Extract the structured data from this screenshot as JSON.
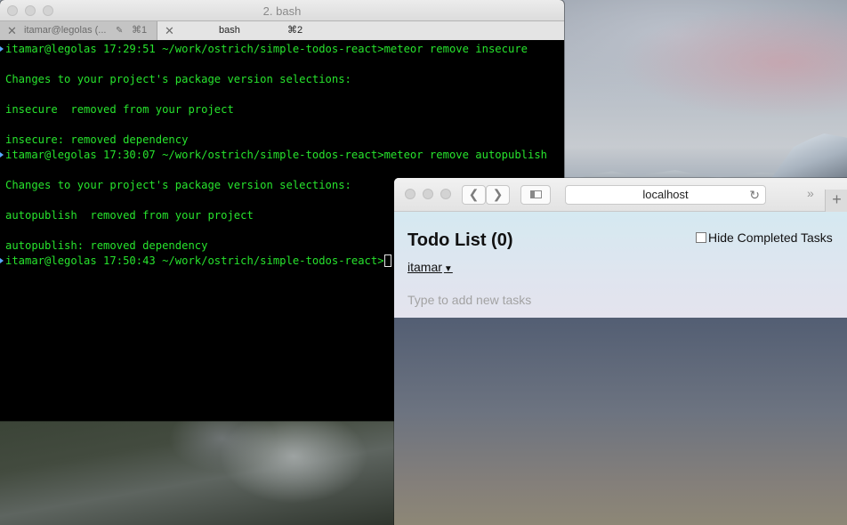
{
  "terminal": {
    "window_title": "2. bash",
    "tabs": [
      {
        "label": "itamar@legolas (...",
        "shortcut": "⌘1"
      },
      {
        "label": "bash",
        "shortcut": "⌘2"
      }
    ],
    "lines": [
      "itamar@legolas 17:29:51 ~/work/ostrich/simple-todos-react>meteor remove insecure",
      "",
      "Changes to your project's package version selections:",
      "",
      "insecure  removed from your project",
      "",
      "insecure: removed dependency",
      "itamar@legolas 17:30:07 ~/work/ostrich/simple-todos-react>meteor remove autopublish",
      "",
      "Changes to your project's package version selections:",
      "",
      "autopublish  removed from your project",
      "",
      "autopublish: removed dependency",
      "itamar@legolas 17:50:43 ~/work/ostrich/simple-todos-react>"
    ]
  },
  "browser": {
    "url": "localhost",
    "app": {
      "title": "Todo List (0)",
      "hide_completed_label": "Hide Completed Tasks",
      "user": "itamar",
      "new_task_placeholder": "Type to add new tasks"
    }
  }
}
